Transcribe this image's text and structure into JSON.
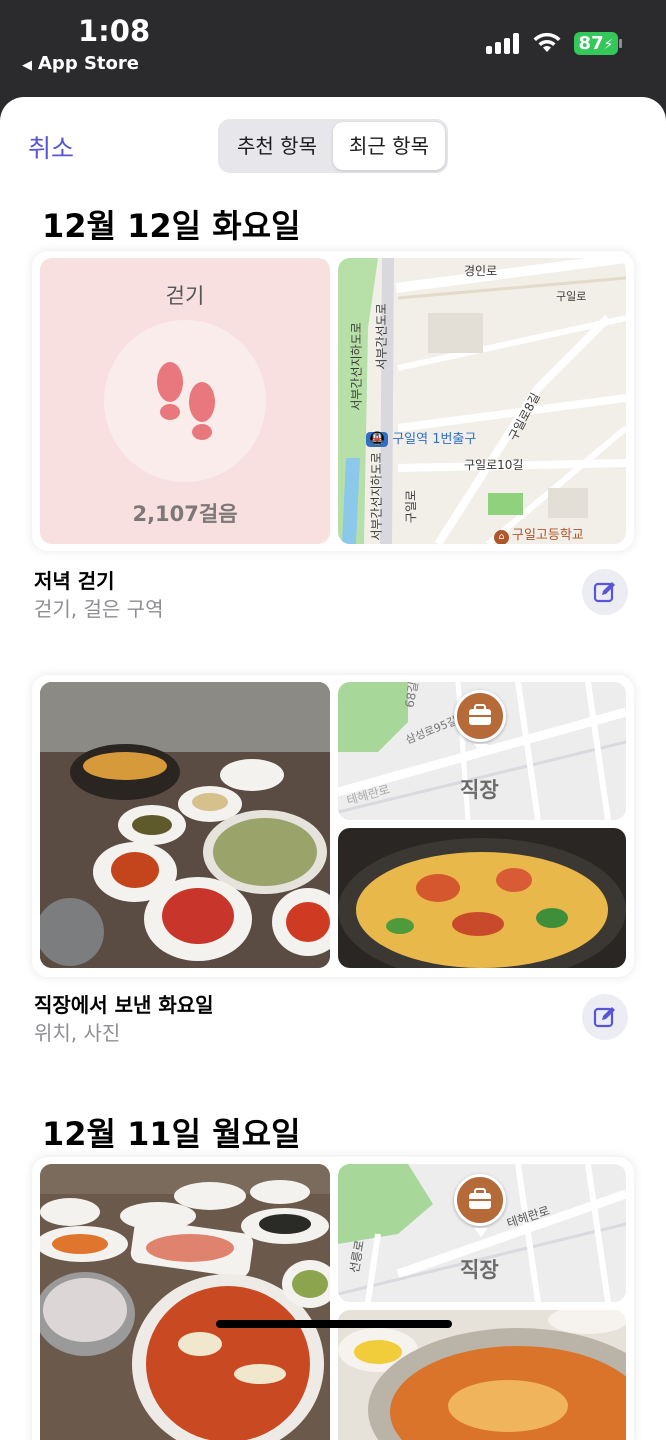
{
  "status_bar": {
    "time": "1:08",
    "back_app": "App Store",
    "battery": "87",
    "colors": {
      "battery": "#34c759"
    }
  },
  "header": {
    "cancel": "취소",
    "tabs": [
      {
        "label": "추천 항목",
        "selected": false
      },
      {
        "label": "최근 항목",
        "selected": true
      }
    ],
    "accent": "#5856d6"
  },
  "sections": [
    {
      "date": "12월 12일 화요일",
      "moments": [
        {
          "walk_label": "걷기",
          "walk_steps": "2,107걸음",
          "map_labels": {
            "station": "구일역 1번출구",
            "school": "구일고등학교",
            "road1": "경인로",
            "road2": "구일로",
            "road3": "구일로8길",
            "road4": "구일로10길",
            "road5": "서부간선지하도로",
            "road6": "서부간선도로",
            "road7": "구일로"
          },
          "title": "저녁 걷기",
          "subtitle": "걷기, 걸은 구역"
        },
        {
          "work_label": "직장",
          "map_labels": {
            "road1": "삼성로95길",
            "road2": "테헤란로",
            "road3": "68길"
          },
          "title": "직장에서 보낸 화요일",
          "subtitle": "위치, 사진"
        }
      ]
    },
    {
      "date": "12월 11일 월요일",
      "moments": [
        {
          "work_label": "직장",
          "map_labels": {
            "road1": "테헤란로",
            "road2": "선릉로"
          }
        }
      ]
    }
  ],
  "icons": {
    "edit": "edit-icon",
    "footprints": "footprints-icon",
    "briefcase": "briefcase-icon",
    "train": "train-icon",
    "school": "school-icon"
  }
}
